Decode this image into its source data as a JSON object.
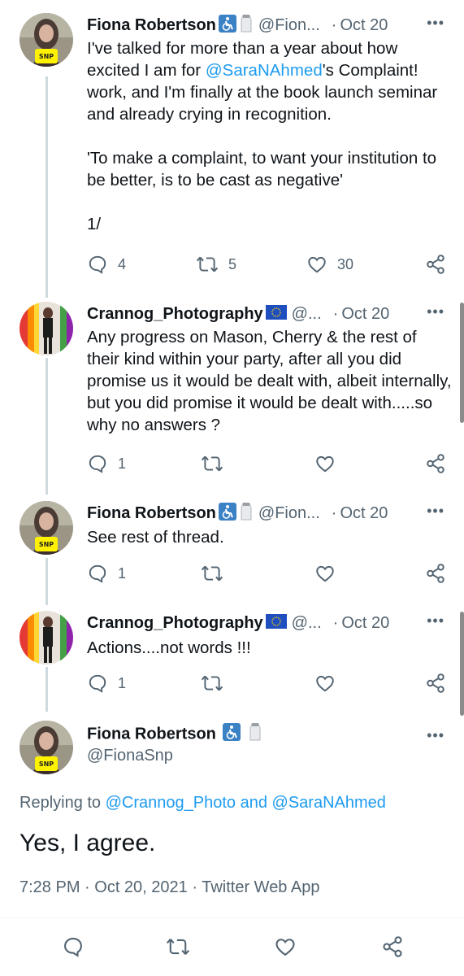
{
  "colors": {
    "accent": "#1d9bf0",
    "text": "#0f1419",
    "secondary": "#536471",
    "thread_line": "#cfd9de"
  },
  "tweets": [
    {
      "name": "Fiona Robertson",
      "badges": [
        "wheelchair-icon",
        "salt-shaker-icon"
      ],
      "handle": "@Fion...",
      "dot": "·",
      "date": "Oct 20",
      "text_before": "I've talked for more than a year about how excited I am for ",
      "mention": "@SaraNAhmed",
      "text_after": "'s Complaint! work, and I'm finally at the book launch seminar and already crying in recognition.\n\n'To make a complaint, to want your institution to be better, is to be cast as negative'\n\n1/",
      "reply_count": "4",
      "retweet_count": "5",
      "like_count": "30"
    },
    {
      "name": "Crannog_Photography",
      "badges": [
        "eu-flag-icon"
      ],
      "handle": "@...",
      "dot": "·",
      "date": "Oct 20",
      "text": "Any progress on Mason, Cherry & the rest of their kind within your party, after all you did promise us it would be dealt with, albeit internally, but you did promise it would be dealt with.....so why no answers ?",
      "reply_count": "1",
      "retweet_count": "",
      "like_count": ""
    },
    {
      "name": "Fiona Robertson",
      "badges": [
        "wheelchair-icon",
        "salt-shaker-icon"
      ],
      "handle": "@Fion...",
      "dot": "·",
      "date": "Oct 20",
      "text": "See rest of thread.",
      "reply_count": "1",
      "retweet_count": "",
      "like_count": ""
    },
    {
      "name": "Crannog_Photography",
      "badges": [
        "eu-flag-icon"
      ],
      "handle": "@...",
      "dot": "·",
      "date": "Oct 20",
      "text": "Actions....not words !!!",
      "reply_count": "1",
      "retweet_count": "",
      "like_count": ""
    }
  ],
  "focus": {
    "name": "Fiona Robertson",
    "handle": "@FionaSnp",
    "replying_prefix": "Replying to ",
    "replying_user1": "@Crannog_Photo",
    "replying_and": " and ",
    "replying_user2": "@SaraNAhmed",
    "text": "Yes, I agree.",
    "time": "7:28 PM",
    "date": "Oct 20, 2021",
    "source": "Twitter Web App",
    "meta_sep": " · "
  },
  "more_label": "•••",
  "avatar_badge_text": "SNP"
}
